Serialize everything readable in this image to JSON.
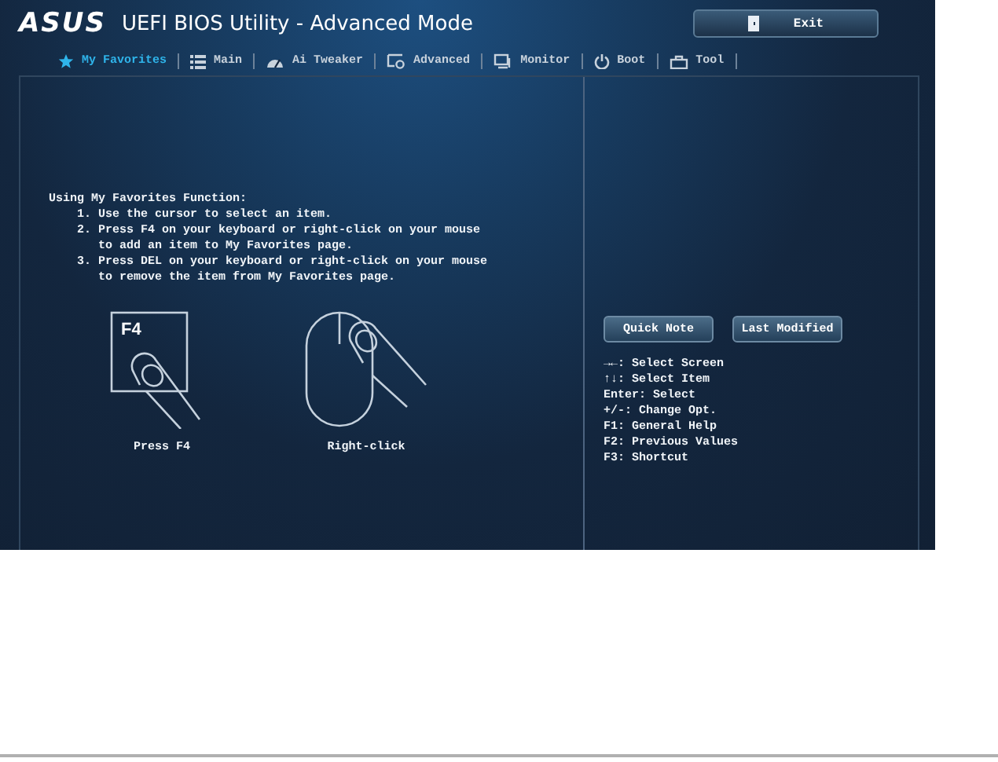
{
  "window": {
    "logo": "ASUS",
    "title": "UEFI BIOS Utility - Advanced Mode",
    "exit_button": "Exit"
  },
  "tabs": [
    {
      "label": "My Favorites",
      "selected": true
    },
    {
      "label": "Main",
      "selected": false
    },
    {
      "label": "Ai Tweaker",
      "selected": false
    },
    {
      "label": "Advanced",
      "selected": false
    },
    {
      "label": "Monitor",
      "selected": false
    },
    {
      "label": "Boot",
      "selected": false
    },
    {
      "label": "Tool",
      "selected": false
    }
  ],
  "instructions": {
    "heading": "Using My Favorites Function:",
    "steps": [
      "1. Use the cursor to select an item.",
      "2. Press F4 on your keyboard or right-click on your mouse to add an item to My Favorites page.",
      "3. Press DEL on your keyboard or right-click on your mouse to remove the item from My Favorites page."
    ]
  },
  "illustrations": [
    {
      "kind": "key",
      "key_label": "F4",
      "caption": "Press F4"
    },
    {
      "kind": "mouse",
      "caption": "Right-click"
    }
  ],
  "side_buttons": [
    "Quick Note",
    "Last Modified"
  ],
  "key_help": [
    "→←: Select Screen",
    "↑↓: Select Item",
    "Enter: Select",
    "+/-: Change Opt.",
    "F1: General Help",
    "F2: Previous Values",
    "F3: Shortcut"
  ]
}
